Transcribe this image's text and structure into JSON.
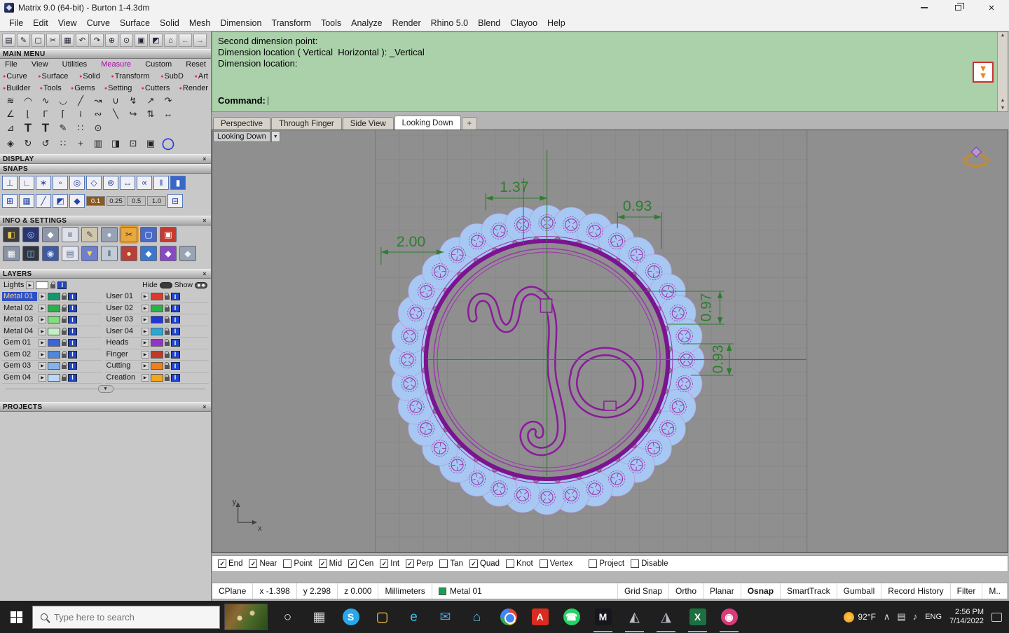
{
  "window": {
    "title": "Matrix 9.0 (64-bit) - Burton 1-4.3dm"
  },
  "ui_glyphs": {
    "close": "×",
    "arrow_right": "▶",
    "dropdown": "▼",
    "up": "▲",
    "down": "▼",
    "check": "✓",
    "plus_tab": "+"
  },
  "menubar": {
    "items": [
      "File",
      "Edit",
      "View",
      "Curve",
      "Surface",
      "Solid",
      "Mesh",
      "Dimension",
      "Transform",
      "Tools",
      "Analyze",
      "Render",
      "Rhino 5.0",
      "Blend",
      "Clayoo",
      "Help"
    ]
  },
  "sidebar": {
    "toolbar_icons": [
      "▤",
      "✎",
      "▢",
      "✂",
      "▦",
      "↶",
      "↷",
      "⊕",
      "⊙",
      "▣",
      "◩",
      "⌂",
      "←",
      "→"
    ],
    "main_menu": {
      "title": "MAIN MENU",
      "tabs": [
        {
          "label": "File"
        },
        {
          "label": "View"
        },
        {
          "label": "Utilities"
        },
        {
          "label": "Measure",
          "active": true
        },
        {
          "label": "Custom"
        },
        {
          "label": "Reset"
        }
      ],
      "row1": [
        "Curve",
        "Surface",
        "Solid",
        "Transform",
        "SubD",
        "Art"
      ],
      "row2": [
        "Builder",
        "Tools",
        "Gems",
        "Setting",
        "Cutters",
        "Render"
      ]
    },
    "tool_rows": [
      [
        "≋",
        "◠",
        "∿",
        "◡",
        "╱",
        "↝",
        "∪",
        "↯",
        "↗",
        "↷"
      ],
      [
        "∠",
        "⌊",
        "Γ",
        "⌈",
        "≀",
        "∾",
        "╲",
        "↪",
        "⇅",
        "↔"
      ],
      [
        "⊿",
        "T",
        "T",
        "✎",
        "∷",
        "⊙"
      ],
      [
        "◈",
        "↻",
        "↺",
        "∷",
        "+",
        "▥",
        "◨",
        "⊡",
        "▣",
        "◯"
      ]
    ],
    "display_header": "DISPLAY",
    "snaps": {
      "header": "SNAPS",
      "row1": [
        {
          "g": "⊥"
        },
        {
          "g": "∟"
        },
        {
          "g": "∗"
        },
        {
          "g": "∘"
        },
        {
          "g": "◎"
        },
        {
          "g": "◇"
        },
        {
          "g": "⊚"
        },
        {
          "g": "↔"
        },
        {
          "g": "∝"
        },
        {
          "g": "‖"
        },
        {
          "g": "▮",
          "active": true
        }
      ],
      "row2": [
        {
          "g": "⊞"
        },
        {
          "g": "▦"
        },
        {
          "g": "╱"
        },
        {
          "g": "◩"
        },
        {
          "g": "◆"
        }
      ],
      "values": [
        {
          "v": "0.1",
          "active": true
        },
        {
          "v": "0.25"
        },
        {
          "v": "0.5"
        },
        {
          "v": "1.0"
        }
      ],
      "row2_end": [
        {
          "g": "⊟"
        }
      ]
    },
    "info": {
      "header": "INFO & SETTINGS",
      "row1": [
        {
          "c": "#3c3c46",
          "g": "◧",
          "t": "#e8c84a"
        },
        {
          "c": "#2a3670",
          "g": "◎",
          "t": "#aac0ff"
        },
        {
          "c": "#8c98a8",
          "g": "◆",
          "t": "#ffffff"
        },
        {
          "c": "#dde0ea",
          "g": "≡",
          "t": "#445066"
        },
        {
          "c": "#cfc6ae",
          "g": "✎",
          "t": "#554c3a"
        },
        {
          "c": "#98a2b4",
          "g": "●",
          "t": "#e8ecf4"
        },
        {
          "c": "#e8a83a",
          "g": "✂",
          "t": "#3a3020",
          "sel": true
        },
        {
          "c": "#4a6ac8",
          "g": "▢",
          "t": "#ffffff"
        },
        {
          "c": "#c8392e",
          "g": "▣",
          "t": "#ffffff"
        }
      ],
      "row2": [
        {
          "c": "#8894a4",
          "g": "▦",
          "t": "#ffffff"
        },
        {
          "c": "#2e3640",
          "g": "◫",
          "t": "#9ac8ff"
        },
        {
          "c": "#3e5aa0",
          "g": "◉",
          "t": "#cfe4ff"
        },
        {
          "c": "#e4e6ee",
          "g": "▤",
          "t": "#566a80"
        },
        {
          "c": "#6e80cc",
          "g": "▼",
          "t": "#ffd84a"
        },
        {
          "c": "#c2ccd6",
          "g": "‖",
          "t": "#34445a"
        },
        {
          "c": "#b8403a",
          "g": "●",
          "t": "#ffe8b0"
        },
        {
          "c": "#3a78d0",
          "g": "◆",
          "t": "#ffffff"
        },
        {
          "c": "#8848c0",
          "g": "◆",
          "t": "#ffffff"
        },
        {
          "c": "#9aa4b0",
          "g": "◆",
          "t": "#eef2f8"
        }
      ]
    },
    "layers": {
      "header": "LAYERS",
      "lights": "Lights",
      "hide": "Hide",
      "show": "Show",
      "left": [
        {
          "name": "Metal 01",
          "color": "#0e9a6e",
          "selected": true
        },
        {
          "name": "Metal 02",
          "color": "#2ab14c"
        },
        {
          "name": "Metal 03",
          "color": "#82dc82"
        },
        {
          "name": "Metal 04",
          "color": "#c6efc6"
        },
        {
          "name": "Gem 01",
          "color": "#3b66d6"
        },
        {
          "name": "Gem 02",
          "color": "#4f86e0"
        },
        {
          "name": "Gem 03",
          "color": "#84b2ec"
        },
        {
          "name": "Gem 04",
          "color": "#bcd8f6"
        }
      ],
      "right": [
        {
          "name": "User 01",
          "color": "#e03a2e"
        },
        {
          "name": "User 02",
          "color": "#2cb04a"
        },
        {
          "name": "User 03",
          "color": "#2236d6"
        },
        {
          "name": "User 04",
          "color": "#28a8d8"
        },
        {
          "name": "Heads",
          "color": "#9632c8"
        },
        {
          "name": "Finger",
          "color": "#c03a28"
        },
        {
          "name": "Cutting",
          "color": "#ee7f1e"
        },
        {
          "name": "Creation",
          "color": "#f0a81e"
        }
      ]
    },
    "projects_header": "PROJECTS"
  },
  "command": {
    "lines": [
      "Second dimension point:",
      "Dimension location ( Vertical  Horizontal ): _Vertical",
      "Dimension location:"
    ],
    "prompt": "Command:"
  },
  "viewport": {
    "tabs": [
      {
        "label": "Perspective"
      },
      {
        "label": "Through Finger"
      },
      {
        "label": "Side View"
      },
      {
        "label": "Looking Down",
        "active": true
      },
      {
        "label": "+",
        "new": true
      }
    ],
    "view_label": "Looking Down",
    "dims": {
      "top": "1.37",
      "top_right": "0.93",
      "left": "2.00",
      "right_upper": "0.97",
      "right_lower": "0.93"
    },
    "axis_x": "x",
    "axis_y": "y",
    "gem_count": 36,
    "colors": {
      "metal_ring": "#7c1391",
      "gem_outline": "#9a35ae",
      "halo_fill": "#a6c8f2",
      "dimension": "#2e7d2e",
      "axis_line": "#cf3030"
    }
  },
  "osnap": {
    "items": [
      {
        "label": "End",
        "checked": true
      },
      {
        "label": "Near",
        "checked": true
      },
      {
        "label": "Point",
        "checked": false
      },
      {
        "label": "Mid",
        "checked": true
      },
      {
        "label": "Cen",
        "checked": true
      },
      {
        "label": "Int",
        "checked": true
      },
      {
        "label": "Perp",
        "checked": true
      },
      {
        "label": "Tan",
        "checked": false
      },
      {
        "label": "Quad",
        "checked": true
      },
      {
        "label": "Knot",
        "checked": false
      },
      {
        "label": "Vertex",
        "checked": false
      },
      {
        "label": "Project",
        "checked": false
      },
      {
        "label": "Disable",
        "checked": false
      }
    ]
  },
  "statusbar": {
    "items": [
      {
        "label": "CPlane"
      },
      {
        "label": "x -1.398"
      },
      {
        "label": "y 2.298"
      },
      {
        "label": "z 0.000"
      },
      {
        "label": "Millimeters"
      },
      {
        "label": "Metal 01",
        "swatch": "#18a050",
        "wide": true
      },
      {
        "label": "Grid Snap"
      },
      {
        "label": "Ortho"
      },
      {
        "label": "Planar"
      },
      {
        "label": "Osnap",
        "bold": true
      },
      {
        "label": "SmartTrack"
      },
      {
        "label": "Gumball"
      },
      {
        "label": "Record History"
      },
      {
        "label": "Filter"
      },
      {
        "label": "M.."
      }
    ]
  },
  "taskbar": {
    "search_placeholder": "Type here to search",
    "temp": "92°F",
    "lang": "ENG",
    "time": "2:56 PM",
    "date": "7/14/2022",
    "icons": [
      {
        "name": "cortana-icon",
        "g": "○",
        "fg": "#e8e8e8"
      },
      {
        "name": "task-view-icon",
        "g": "▦",
        "fg": "#d8d8d8"
      },
      {
        "name": "skype-icon",
        "g": "S",
        "fg": "#ffffff",
        "bg": "#28a8ea",
        "round": true
      },
      {
        "name": "file-explorer-icon",
        "g": "▢",
        "fg": "#ffd24a"
      },
      {
        "name": "edge-icon",
        "g": "e",
        "fg": "#38c2e8"
      },
      {
        "name": "mail-icon",
        "g": "✉",
        "fg": "#4aa6e8"
      },
      {
        "name": "store-icon",
        "g": "⌂",
        "fg": "#58b8e8"
      },
      {
        "name": "chrome-icon",
        "special": "chrome"
      },
      {
        "name": "acrobat-icon",
        "g": "A",
        "fg": "#ffffff",
        "bg": "#d92b1f"
      },
      {
        "name": "whatsapp-icon",
        "g": "☎",
        "fg": "#ffffff",
        "bg": "#25d366",
        "round": true
      },
      {
        "name": "matrix-icon",
        "g": "M",
        "fg": "#f0f0f0",
        "bg": "#16161e",
        "open": true
      },
      {
        "name": "modeling-app-icon-1",
        "g": "◭",
        "fg": "#c0c0c8",
        "open": true
      },
      {
        "name": "modeling-app-icon-2",
        "g": "◮",
        "fg": "#b8b8c0",
        "open": true
      },
      {
        "name": "excel-icon",
        "g": "X",
        "fg": "#ffffff",
        "bg": "#1d6f42",
        "open": true
      },
      {
        "name": "photo-app-icon",
        "g": "◉",
        "fg": "#ffffff",
        "bg": "#d83a7c",
        "round": true,
        "open": true
      }
    ],
    "tray_icons": [
      {
        "name": "chevron-up-icon",
        "g": "∧"
      },
      {
        "name": "touch-keyboard-icon",
        "g": "▤"
      },
      {
        "name": "volume-icon",
        "g": "♪"
      }
    ]
  }
}
